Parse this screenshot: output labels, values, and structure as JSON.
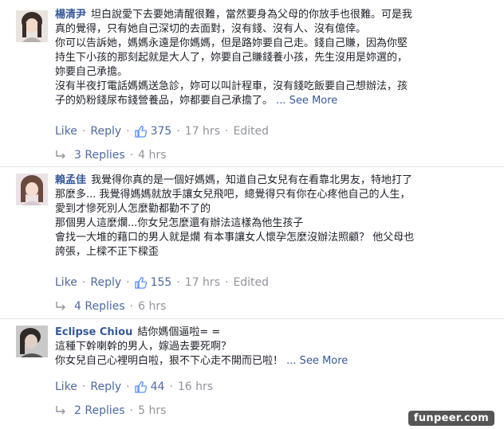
{
  "comments": [
    {
      "author": "楊清尹",
      "lines": [
        "坦白說愛下去要她清醒很難，當然要身為父母的你放手也很難。可是我",
        "真的覺得，只有她自己深切的去面對，沒有錢、沒有人、沒有億倖。",
        "你可以告訴她，媽媽永遠是你媽媽，但是路妳要自己走。錢自己賺，因為你堅",
        "持生下小孩的那刻起就是大人了，妳要自己賺錢養小孩，先生沒用是妳選的，",
        "妳要自己承擔。",
        "沒有半夜打電話媽媽送急診，妳可以叫計程車，沒有錢吃飯要自己想辦法，孩",
        "子的奶粉錢尿布錢營養品，妳都要自己承擔了。"
      ],
      "see_more": "... See More",
      "like_label": "Like",
      "reply_label": "Reply",
      "likes": "375",
      "time": "17 hrs",
      "edited": "Edited",
      "replies_label": "3 Replies",
      "replies_time": "4 hrs"
    },
    {
      "author": "賴孟佳",
      "lines": [
        "我覺得你真的是一個好媽媽，知道自己女兒有在看靠北男友，特地打了",
        "那麼多... 我覺得媽媽就放手讓女兒飛吧，總覺得只有你在心疼他自己的人生，",
        "愛到才慘死別人怎麼勸都勸不了的",
        "那個男人這麼爛...你女兒怎麼還有辦法這樣為他生孩子",
        "會找一大堆的藉口的男人就是爛 有本事讓女人懷孕怎麼沒辦法照顧？ 他父母也",
        "誇張，上樑不正下樑歪"
      ],
      "see_more": "",
      "like_label": "Like",
      "reply_label": "Reply",
      "likes": "155",
      "time": "17 hrs",
      "edited": "Edited",
      "replies_label": "4 Replies",
      "replies_time": "6 hrs"
    },
    {
      "author": "Eclipse Chiou",
      "lines": [
        "結你媽個逼啦= =",
        "這種下幹喇幹的男人，嫁過去要死啊？",
        "你女兒自己心裡明白啦，狠不下心走不開而已啦！"
      ],
      "see_more": "... See More",
      "like_label": "Like",
      "reply_label": "Reply",
      "likes": "44",
      "time": "16 hrs",
      "edited": "",
      "replies_label": "2 Replies",
      "replies_time": "5 hrs"
    }
  ],
  "watermark": "funpeer.com",
  "colors": {
    "link": "#365899",
    "meta": "#90949c",
    "text": "#1d2129"
  }
}
